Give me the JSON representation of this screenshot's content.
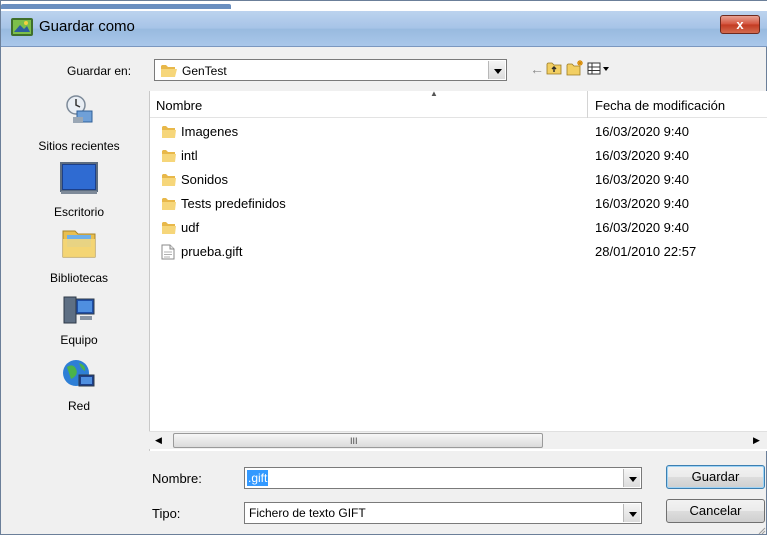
{
  "window": {
    "title": "Guardar como",
    "close_label": "x"
  },
  "location": {
    "label": "Guardar en:",
    "current_folder": "GenTest"
  },
  "toolbar": {
    "back_icon": "back-arrow-icon",
    "up_icon": "up-folder-icon",
    "new_folder_icon": "new-folder-icon",
    "view_icon": "view-menu-icon",
    "back_glyph": "←"
  },
  "sidebar": {
    "places": [
      {
        "label": "Sitios recientes",
        "icon": "recent-places-icon"
      },
      {
        "label": "Escritorio",
        "icon": "desktop-icon"
      },
      {
        "label": "Bibliotecas",
        "icon": "libraries-icon"
      },
      {
        "label": "Equipo",
        "icon": "computer-icon"
      },
      {
        "label": "Red",
        "icon": "network-icon"
      }
    ]
  },
  "file_list": {
    "columns": {
      "name": "Nombre",
      "date": "Fecha de modificación"
    },
    "rows": [
      {
        "name": "Imagenes",
        "date": "16/03/2020 9:40",
        "type": "folder"
      },
      {
        "name": "intl",
        "date": "16/03/2020 9:40",
        "type": "folder"
      },
      {
        "name": "Sonidos",
        "date": "16/03/2020 9:40",
        "type": "folder"
      },
      {
        "name": "Tests predefinidos",
        "date": "16/03/2020 9:40",
        "type": "folder"
      },
      {
        "name": "udf",
        "date": "16/03/2020 9:40",
        "type": "folder"
      },
      {
        "name": "prueba.gift",
        "date": "28/01/2010 22:57",
        "type": "file"
      }
    ]
  },
  "scrollbar": {
    "grip": "III",
    "left_arrow": "◀",
    "right_arrow": "▶"
  },
  "form": {
    "name_label": "Nombre:",
    "name_value": ".gift",
    "type_label": "Tipo:",
    "type_value": "Fichero de texto GIFT"
  },
  "buttons": {
    "save": "Guardar",
    "cancel": "Cancelar"
  },
  "colors": {
    "selection": "#3399ff",
    "title_bar": "#a6c3e7",
    "close_button": "#c23a21"
  }
}
